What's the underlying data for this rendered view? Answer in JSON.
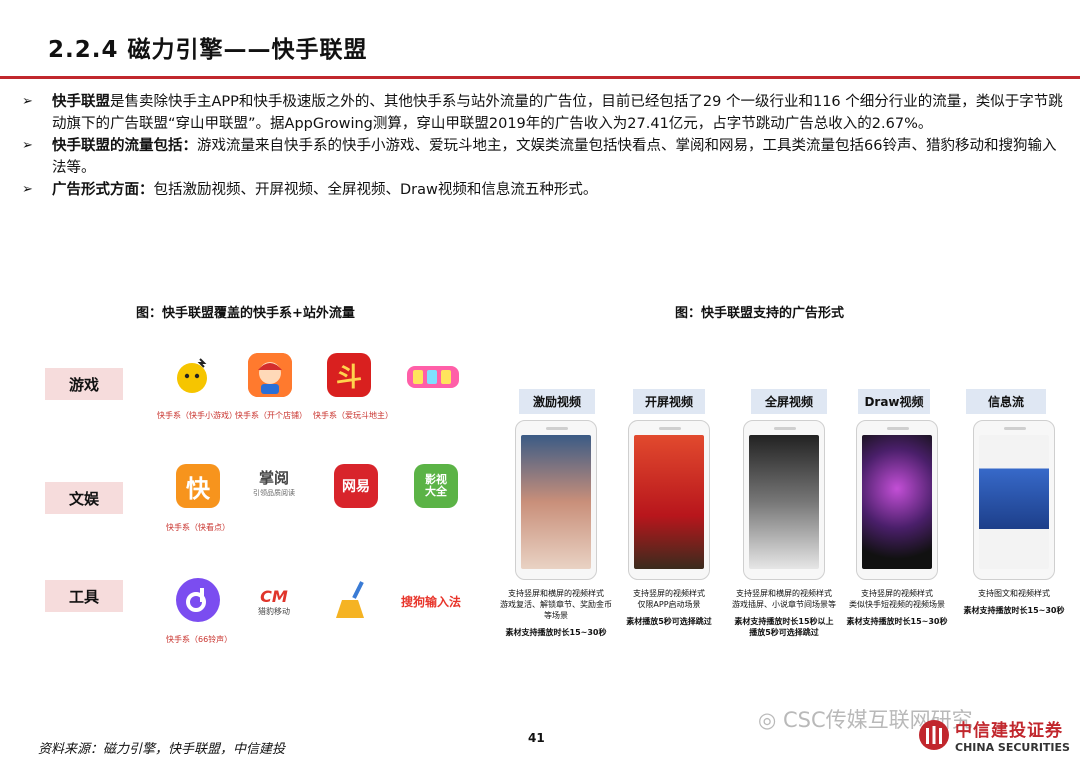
{
  "title": "2.2.4 磁力引擎——快手联盟",
  "bullets": [
    {
      "bold": "快手联盟",
      "text": "是售卖除快手主APP和快手极速版之外的、其他快手系与站外流量的广告位，目前已经包括了29 个一级行业和116 个细分行业的流量，类似于字节跳动旗下的广告联盟“穿山甲联盟”。据AppGrowing测算，穿山甲联盟2019年的广告收入为27.41亿元，占字节跳动广告总收入的2.67%。"
    },
    {
      "bold": "快手联盟的流量包括：",
      "text": "游戏流量来自快手系的快手小游戏、爱玩斗地主，文娱类流量包括快看点、掌阅和网易，工具类流量包括66铃声、猎豹移动和搜狗输入法等。"
    },
    {
      "bold": "广告形式方面：",
      "text": "包括激励视频、开屏视频、全屏视频、Draw视频和信息流五种形式。"
    }
  ],
  "bullet_mark": "➢",
  "figure_left": {
    "caption": "图：快手联盟覆盖的快手系+站外流量",
    "categories": [
      "游戏",
      "文娱",
      "工具"
    ],
    "app_captions": [
      "快手系（快手小游戏）",
      "快手系（开个店铺）",
      "快手系（爱玩斗地主）",
      "快手系（快看点）",
      "快手系（66铃声）"
    ],
    "app_logos": {
      "douzhu": "斗",
      "kuai": "快",
      "zhangyue": "掌阅",
      "zhangyue_sub": "引领品质阅读",
      "wangyi": "网易",
      "yingshi": "影视大全",
      "cm": "CM",
      "cm_sub": "猎豹移动",
      "sogou": "搜狗输入法"
    }
  },
  "figure_right": {
    "caption": "图：快手联盟支持的广告形式",
    "formats": [
      {
        "label": "激励视频",
        "desc": "支持竖屏和横屏的视频样式\n游戏复活、解锁章节、奖励金币等场景",
        "note": "素材支持播放时长15~30秒"
      },
      {
        "label": "开屏视频",
        "desc": "支持竖屏的视频样式\n仅限APP启动场景",
        "note": "素材播放5秒可选择跳过"
      },
      {
        "label": "全屏视频",
        "desc": "支持竖屏和横屏的视频样式\n游戏插屏、小说章节间场景等",
        "note": "素材支持播放时长15秒以上\n播放5秒可选择跳过"
      },
      {
        "label": "Draw视频",
        "desc": "支持竖屏的视频样式\n类似快手短视频的视频场景",
        "note": "素材支持播放时长15~30秒"
      },
      {
        "label": "信息流",
        "desc": "支持图文和视频样式",
        "note": "素材支持播放时长15~30秒"
      }
    ]
  },
  "footer": {
    "source": "资料来源：磁力引擎，快手联盟，中信建投",
    "page": "41",
    "watermark": "CSC传媒互联网研究",
    "brand_cn": "中信建投证券",
    "brand_en": "CHINA SECURITIES"
  },
  "colors": {
    "accent": "#c1272d",
    "category_bg": "#f6dcdc",
    "format_bg": "#dfe7f3"
  }
}
